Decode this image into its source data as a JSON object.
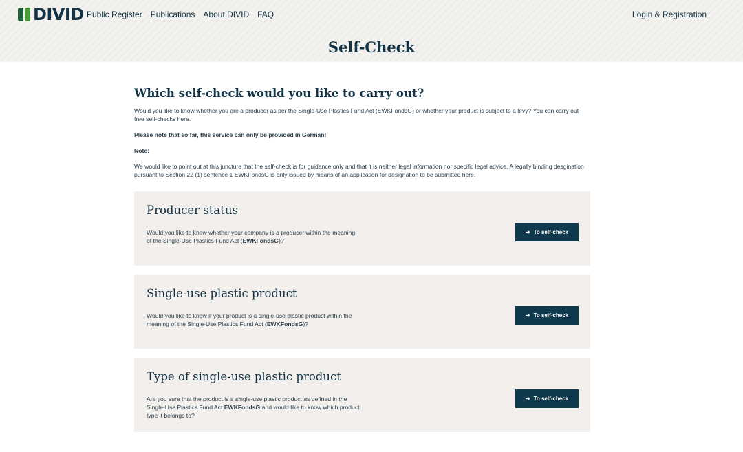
{
  "header": {
    "logo_text": "DIVID",
    "nav": [
      "Public Register",
      "Publications",
      "About DIVID",
      "FAQ"
    ],
    "login": "Login & Registration",
    "colors": {
      "brand_dark": "#123345",
      "logo_green": "#4a9a3b",
      "logo_dark_green": "#1f5e36"
    }
  },
  "page": {
    "title": "Self-Check"
  },
  "main": {
    "heading": "Which self-check would you like to carry out?",
    "intro": "Would you like to know whether you are a producer as per the Single-Use Plastics Fund Act (EWKFondsG) or whether your product is subject to a levy? You can carry out free self-checks here.",
    "german_notice": "Please note that so far, this service can only be provided in German!",
    "note_label": "Note:",
    "note_text": "We would like to point out at this juncture that the self-check is for guidance only and that it is neither legal information nor specific legal advice. A legally binding desgination pursuant to Section 22 (1) sentence 1 EWKFondsG is only issued by means of an application for designation to be submitted here."
  },
  "cards": [
    {
      "title": "Producer status",
      "desc_before": "Would you like to know whether your company is a producer within the meaning of the Single-Use Plastics Fund Act (",
      "desc_bold": "EWKFondsG",
      "desc_after": ")?",
      "button": "To self-check",
      "button_icon": "arrow-right"
    },
    {
      "title": "Single-use plastic product",
      "desc_before": "Would you like to know if your product is a single-use plastic product within the meaning of the Single-Use Plastics Fund Act (",
      "desc_bold": "EWKFondsG",
      "desc_after": ")?",
      "button": "To self-check",
      "button_icon": "arrow-right"
    },
    {
      "title": "Type of single-use plastic product",
      "desc_before": "Are you sure that the product is a single-use plastic product as defined in the Single-Use Plastics Fund Act ",
      "desc_bold": "EWKFondsG",
      "desc_after": " and would like to know which product type it belongs to?",
      "button": "To self-check",
      "button_icon": "arrow-right"
    }
  ]
}
